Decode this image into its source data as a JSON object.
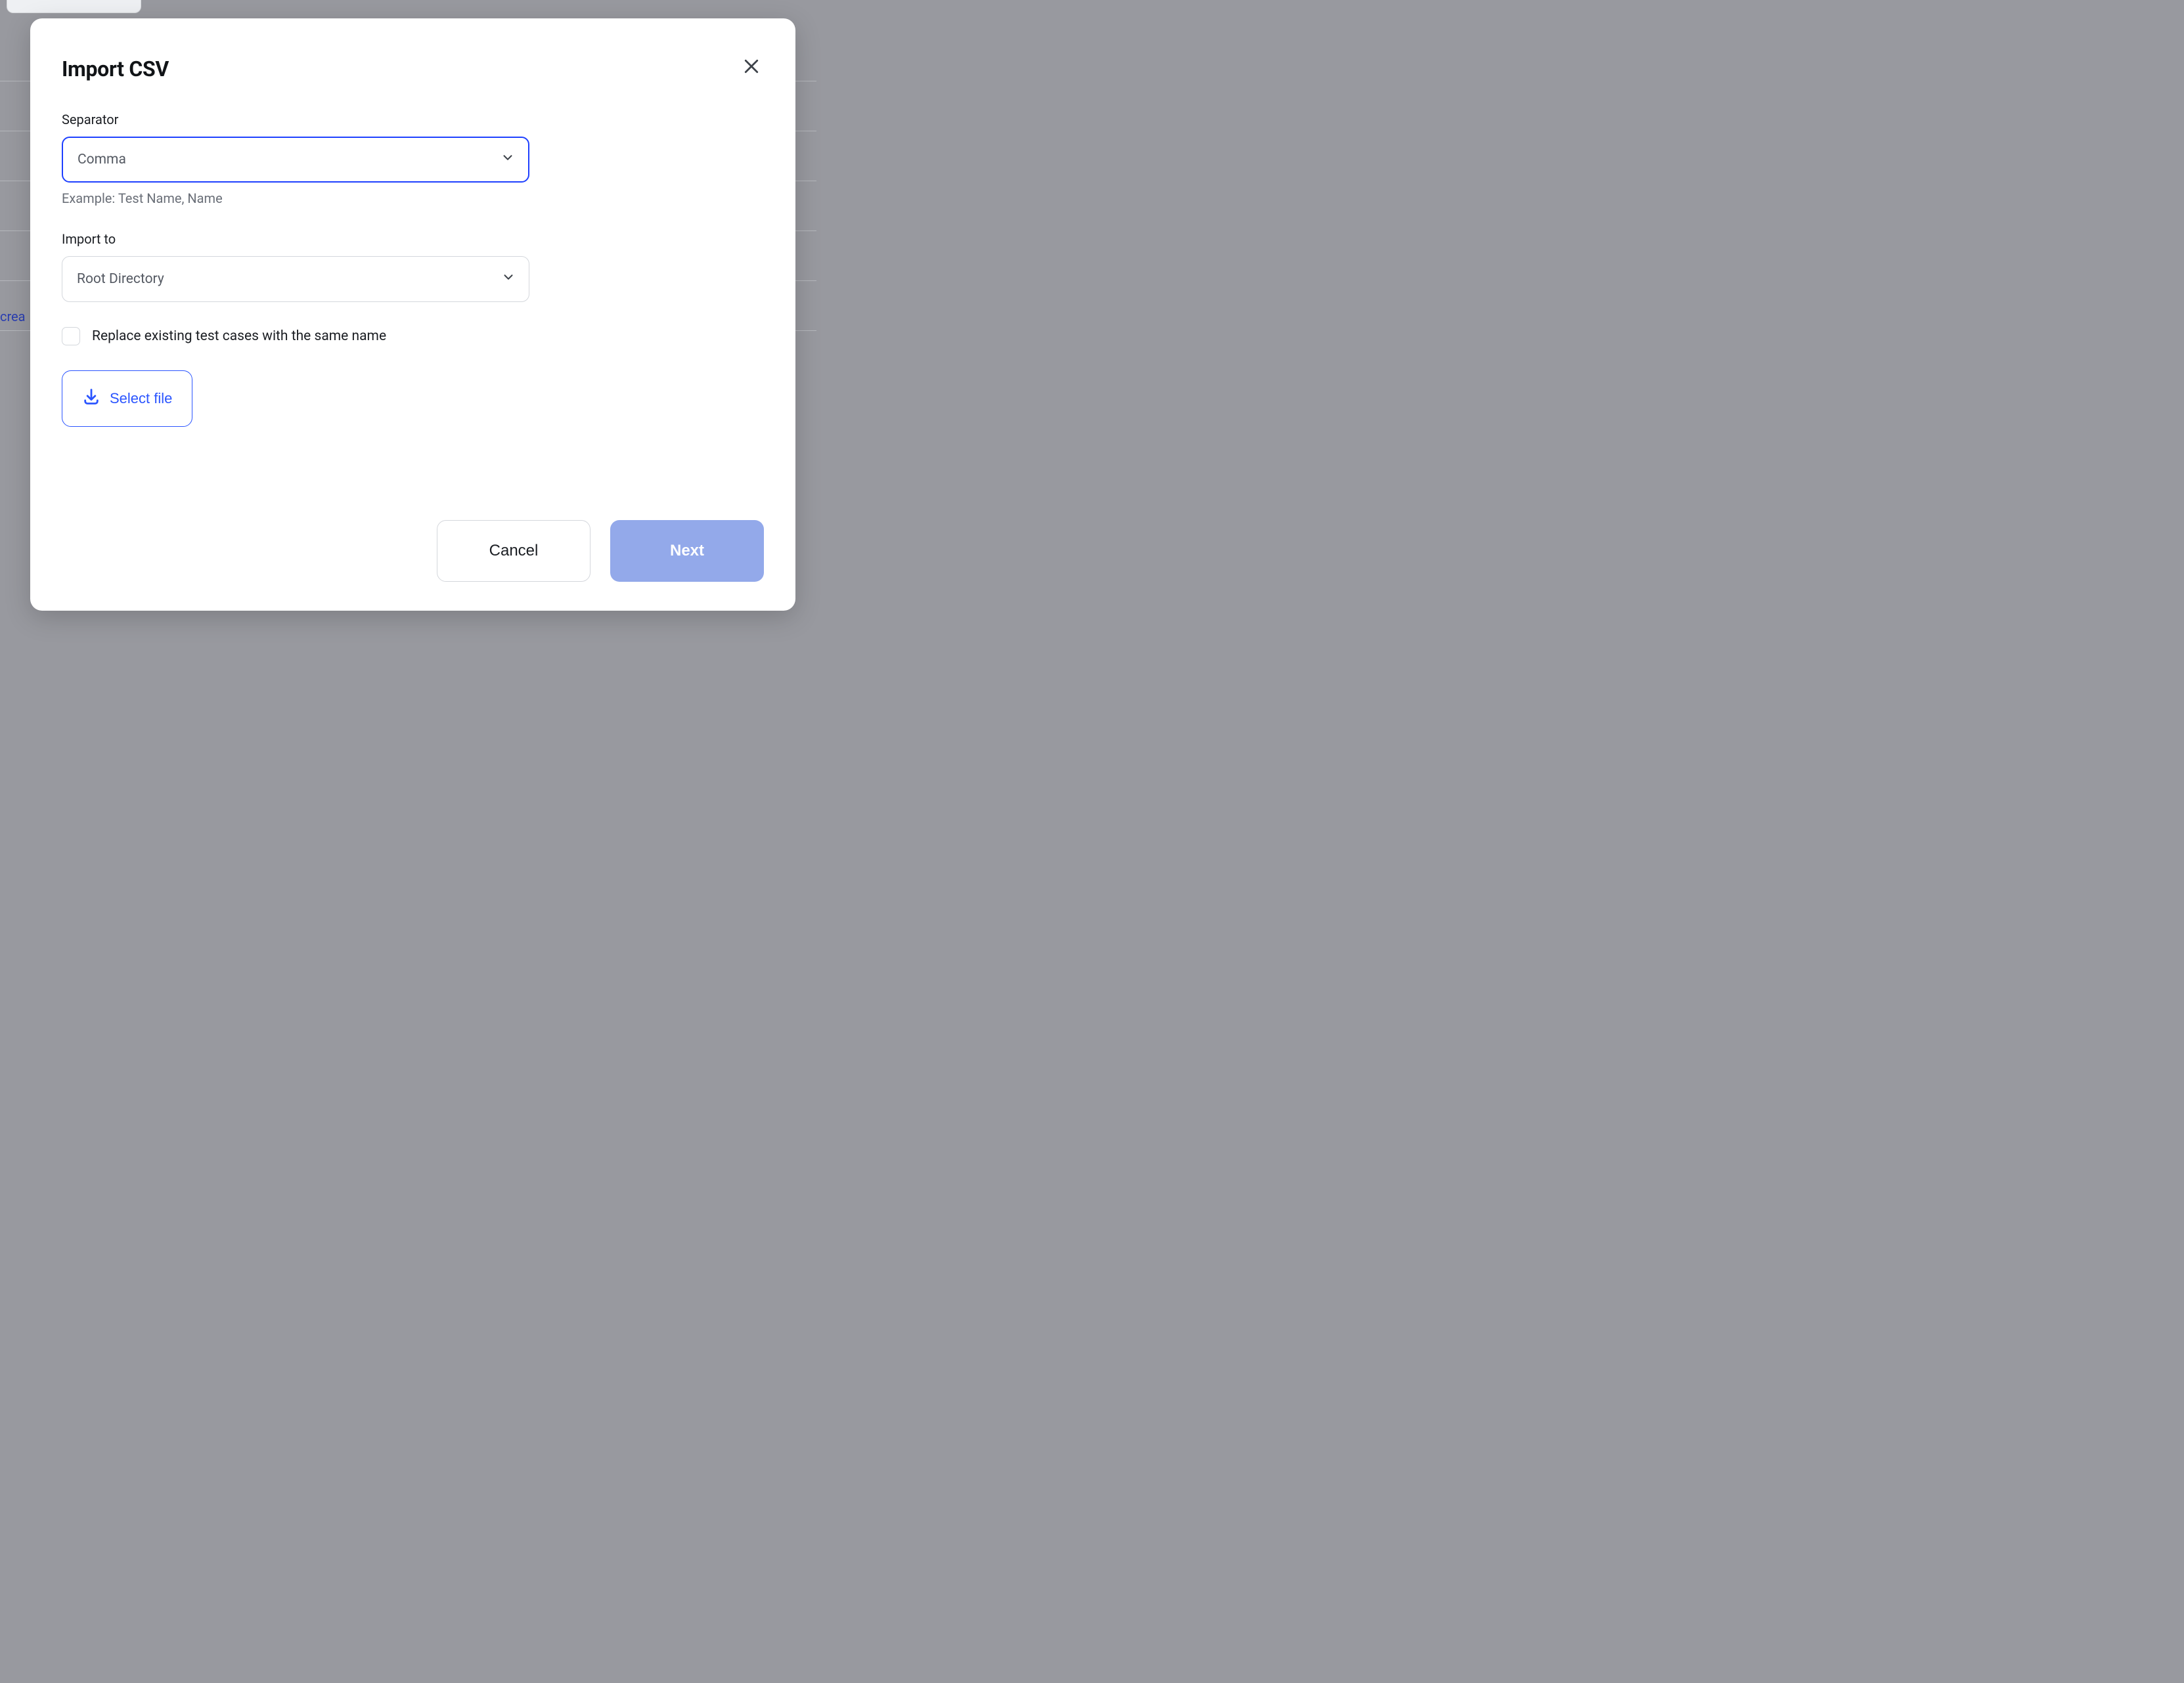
{
  "background": {
    "link_fragment": "crea"
  },
  "modal": {
    "title": "Import CSV",
    "separator": {
      "label": "Separator",
      "value": "Comma",
      "help": "Example: Test Name, Name"
    },
    "import_to": {
      "label": "Import to",
      "value": "Root Directory"
    },
    "replace": {
      "label": "Replace existing test cases with the same name",
      "checked": false
    },
    "select_file_label": "Select file",
    "footer": {
      "cancel": "Cancel",
      "next": "Next"
    }
  }
}
